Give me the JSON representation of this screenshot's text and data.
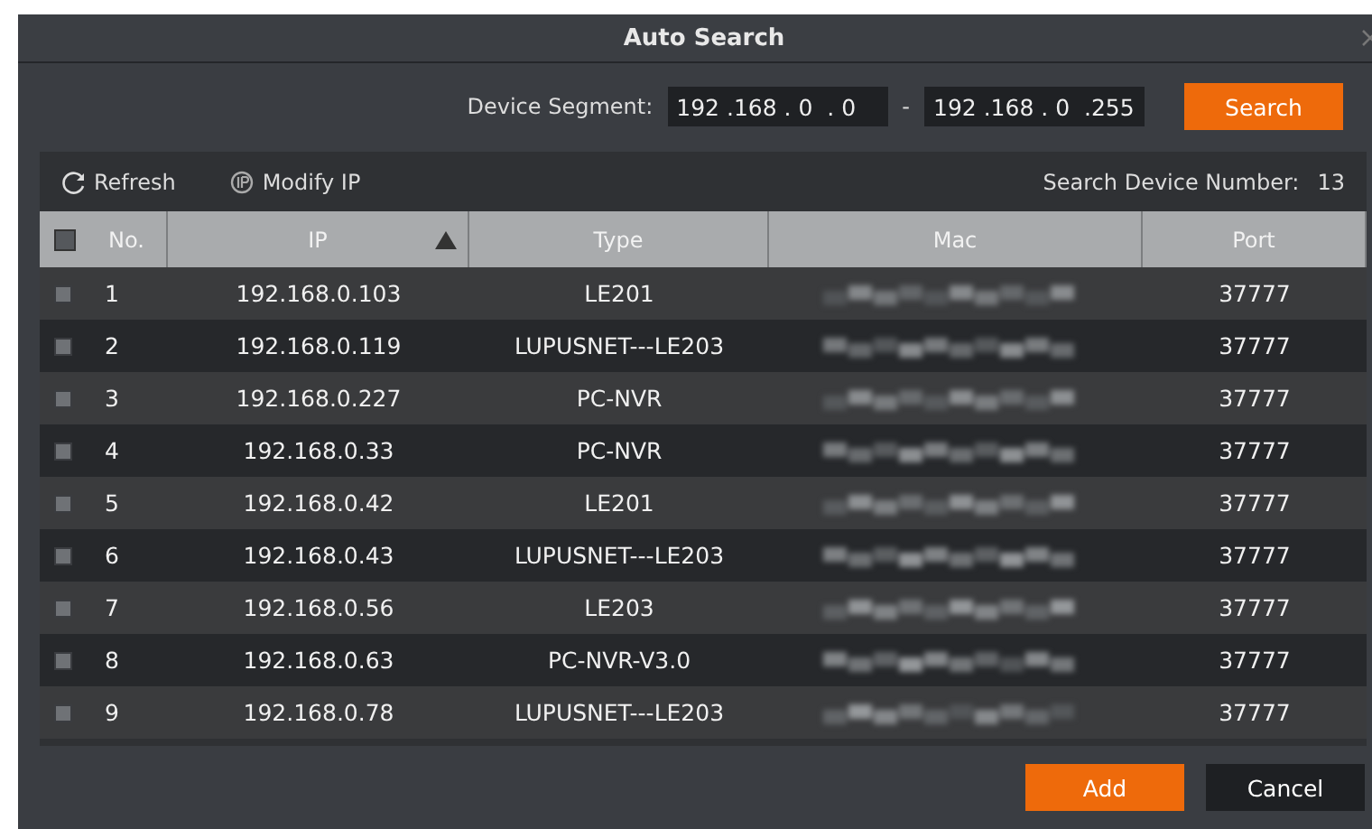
{
  "window": {
    "title": "Auto Search"
  },
  "segment": {
    "label": "Device Segment:",
    "start": "192 .168 . 0  . 0",
    "separator": "-",
    "end": "192 .168 . 0  .255",
    "search_button": "Search"
  },
  "toolbar": {
    "refresh": "Refresh",
    "modify_ip": "Modify IP",
    "count_label": "Search Device Number:",
    "count": "13"
  },
  "table": {
    "select_all_checked": false,
    "columns": [
      {
        "label": "No.",
        "sorted_ascending": false
      },
      {
        "label": "IP",
        "sorted_ascending": true
      },
      {
        "label": "Type",
        "sorted_ascending": false
      },
      {
        "label": "Mac",
        "sorted_ascending": false
      },
      {
        "label": "Port",
        "sorted_ascending": false
      }
    ],
    "rows": [
      {
        "checked": false,
        "no": "1",
        "ip": "192.168.0.103",
        "type": "LE201",
        "port": "37777"
      },
      {
        "checked": false,
        "no": "2",
        "ip": "192.168.0.119",
        "type": "LUPUSNET---LE203",
        "port": "37777"
      },
      {
        "checked": false,
        "no": "3",
        "ip": "192.168.0.227",
        "type": "PC-NVR",
        "port": "37777"
      },
      {
        "checked": false,
        "no": "4",
        "ip": "192.168.0.33",
        "type": "PC-NVR",
        "port": "37777"
      },
      {
        "checked": false,
        "no": "5",
        "ip": "192.168.0.42",
        "type": "LE201",
        "port": "37777"
      },
      {
        "checked": false,
        "no": "6",
        "ip": "192.168.0.43",
        "type": "LUPUSNET---LE203",
        "port": "37777"
      },
      {
        "checked": false,
        "no": "7",
        "ip": "192.168.0.56",
        "type": "LE203",
        "port": "37777"
      },
      {
        "checked": false,
        "no": "8",
        "ip": "192.168.0.63",
        "type": "PC-NVR-V3.0",
        "port": "37777"
      },
      {
        "checked": false,
        "no": "9",
        "ip": "192.168.0.78",
        "type": "LUPUSNET---LE203",
        "port": "37777"
      }
    ]
  },
  "buttons": [
    {
      "label": "Add",
      "kind": "primary"
    },
    {
      "label": "Cancel",
      "kind": "secondary"
    }
  ]
}
